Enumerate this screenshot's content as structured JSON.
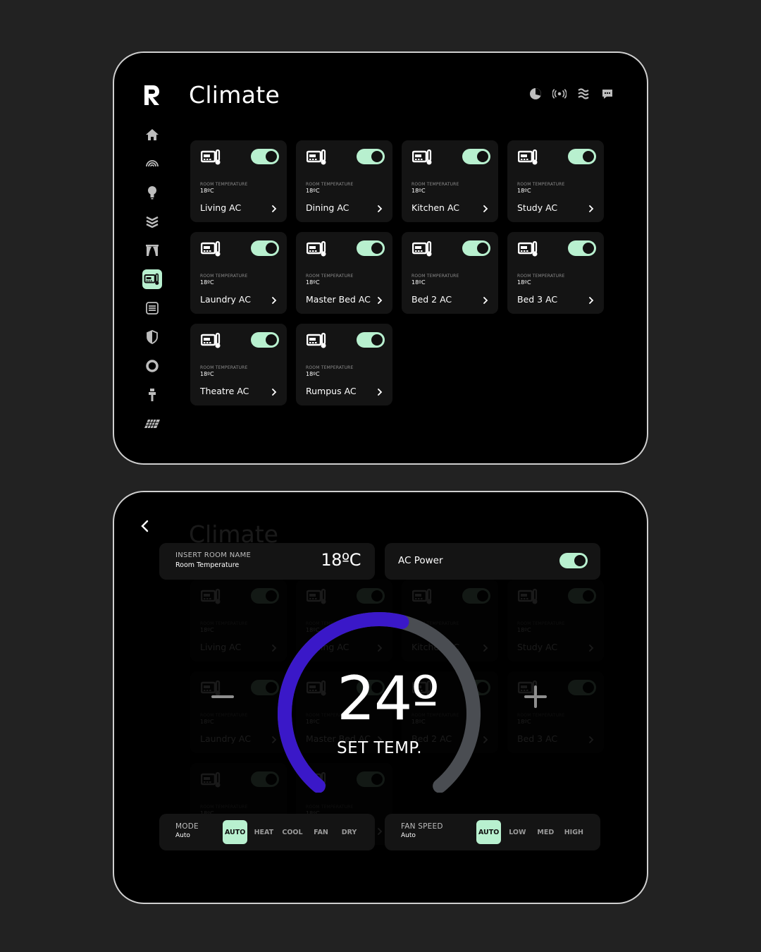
{
  "app": {
    "title": "Climate"
  },
  "colors": {
    "accent": "#b8f0cf",
    "dial_active": "#3a18c8",
    "dial_track": "#4a4d52",
    "background": "#222222"
  },
  "top_icons": [
    "pie-chart-icon",
    "broadcast-icon",
    "heat-waves-icon",
    "chat-bubble-icon"
  ],
  "sidebar": {
    "items": [
      {
        "icon": "home-icon",
        "active": false
      },
      {
        "icon": "wifi-arc-icon",
        "active": false
      },
      {
        "icon": "lightbulb-icon",
        "active": false
      },
      {
        "icon": "layers-icon",
        "active": false
      },
      {
        "icon": "curtains-icon",
        "active": false
      },
      {
        "icon": "air-conditioner-icon",
        "active": true
      },
      {
        "icon": "heater-icon",
        "active": false
      },
      {
        "icon": "shield-icon",
        "active": false
      },
      {
        "icon": "lifebuoy-icon",
        "active": false
      },
      {
        "icon": "sprinkler-icon",
        "active": false
      },
      {
        "icon": "solar-panel-icon",
        "active": false
      }
    ]
  },
  "cards": [
    {
      "label": "ROOM TEMPERATURE",
      "value": "18ºC",
      "name": "Living AC",
      "on": true
    },
    {
      "label": "ROOM TEMPERATURE",
      "value": "18ºC",
      "name": "Dining AC",
      "on": true
    },
    {
      "label": "ROOM TEMPERATURE",
      "value": "18ºC",
      "name": "Kitchen AC",
      "on": true
    },
    {
      "label": "ROOM TEMPERATURE",
      "value": "18ºC",
      "name": "Study AC",
      "on": true
    },
    {
      "label": "ROOM TEMPERATURE",
      "value": "18ºC",
      "name": "Laundry AC",
      "on": true
    },
    {
      "label": "ROOM TEMPERATURE",
      "value": "18ºC",
      "name": "Master Bed AC",
      "on": true
    },
    {
      "label": "ROOM TEMPERATURE",
      "value": "18ºC",
      "name": "Bed 2 AC",
      "on": true
    },
    {
      "label": "ROOM TEMPERATURE",
      "value": "18ºC",
      "name": "Bed 3 AC",
      "on": true
    },
    {
      "label": "ROOM TEMPERATURE",
      "value": "18ºC",
      "name": "Theatre AC",
      "on": true
    },
    {
      "label": "ROOM TEMPERATURE",
      "value": "18ºC",
      "name": "Rumpus AC",
      "on": true
    }
  ],
  "detail": {
    "room_name": "INSERT ROOM NAME",
    "room_sub": "Room Temperature",
    "room_temp": "18ºC",
    "power_label": "AC Power",
    "power_on": true,
    "set_temp": "24º",
    "set_temp_label": "SET TEMP.",
    "dial_level": 0.55,
    "mode": {
      "label": "MODE",
      "value": "Auto",
      "options": [
        "AUTO",
        "HEAT",
        "COOL",
        "FAN",
        "DRY"
      ],
      "selected": 0
    },
    "fan": {
      "label": "FAN SPEED",
      "value": "Auto",
      "options": [
        "AUTO",
        "LOW",
        "MED",
        "HIGH"
      ],
      "selected": 0
    }
  }
}
